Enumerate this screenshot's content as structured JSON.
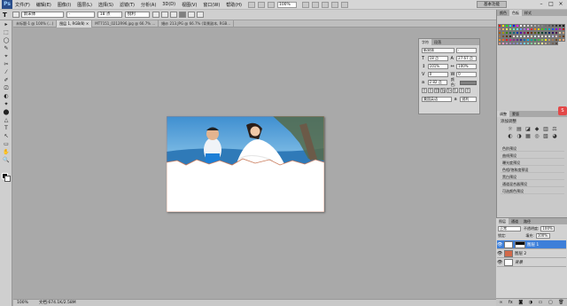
{
  "app": {
    "logo": "Ps",
    "menu": [
      "文件(F)",
      "编辑(E)",
      "图像(I)",
      "图层(L)",
      "选择(S)",
      "滤镜(T)",
      "分析(A)",
      "3D(D)",
      "视图(V)",
      "窗口(W)",
      "帮助(H)"
    ],
    "zoom": "100%",
    "workspace": "基本功能",
    "window_controls": [
      "–",
      "□",
      "×"
    ]
  },
  "options": {
    "tool": "T",
    "font_family": "新宋体",
    "font_style": "-",
    "font_size": "18 点",
    "anti_alias": "锐利"
  },
  "tabs": [
    {
      "label": "未标题-1 @ 100% (...)",
      "active": false
    },
    {
      "label": "图层 1, RGB/8) ×",
      "active": true
    },
    {
      "label": "MT7151_0212R96.jpg @ 66.7% ...",
      "active": false
    },
    {
      "label": "婚纱 213.JPG @ 66.7% (背景副本, RGB...",
      "active": false
    }
  ],
  "toolbox": [
    "▸",
    "⬚",
    "◯",
    "✎",
    "⌖",
    "✂",
    "⁄",
    "✐",
    "⎚",
    "◐",
    "✦",
    "⬤",
    "△",
    "T",
    "↖",
    "▭",
    "✋",
    "🔍"
  ],
  "status": {
    "zoom": "100%",
    "doc": "文档:674.1K/2.58M"
  },
  "character_panel": {
    "tabs": [
      "字符",
      "段落"
    ],
    "font_family": "新宋体",
    "font_style": "-",
    "size": "18 点",
    "leading": "27.67 点",
    "vertical_scale": "101%",
    "horizontal_scale": "100%",
    "kerning": "0",
    "tracking": "0",
    "baseline": "2.82 点",
    "color_label": "颜色:",
    "color": "#808080",
    "language": "美国英语",
    "aa": "锐利",
    "format_buttons": [
      "T",
      "T",
      "TT",
      "Tt",
      "T¹",
      "T,",
      "T",
      "T"
    ]
  },
  "right": {
    "swatch_tabs": [
      "颜色",
      "色板",
      "样式"
    ],
    "adjust_tabs": [
      "调整",
      "蒙版"
    ],
    "adjust_title": "添加调整",
    "adjust_icons": [
      "☼",
      "▤",
      "◪",
      "◆",
      "▥",
      "⚖",
      "◐",
      "◑",
      "▦",
      "◎",
      "▧",
      "◕"
    ],
    "presets": [
      "色阶预设",
      "曲线预设",
      "曝光度预设",
      "色相/饱和度预设",
      "黑白预设",
      "通道混合器预设",
      "可选颜色预设"
    ],
    "layers_tabs": [
      "图层",
      "通道",
      "路径"
    ],
    "blend_mode": "正常",
    "opacity_label": "不透明度:",
    "opacity": "100%",
    "fill_label": "填充:",
    "fill": "100%",
    "lock_label": "锁定:",
    "layers": [
      {
        "name": "图层 1",
        "selected": true
      },
      {
        "name": "图层 2",
        "selected": false
      },
      {
        "name": "背景",
        "selected": false
      }
    ],
    "footer_icons": [
      "∞",
      "fx",
      "◙",
      "◑",
      "▭",
      "▢",
      "🗑"
    ]
  },
  "colors": {
    "swatches": [
      "#ff0000",
      "#ffff00",
      "#00ff00",
      "#00ffff",
      "#0000ff",
      "#ff00ff",
      "#ffffff",
      "#ebebeb",
      "#d6d6d6",
      "#c2c2c2",
      "#adadad",
      "#999999",
      "#858585",
      "#707070",
      "#5c5c5c",
      "#474747",
      "#333333",
      "#1f1f1f",
      "#000000",
      "#ff6b6b",
      "#ffb36b",
      "#fff36b",
      "#a8ff6b",
      "#6bffb5",
      "#6bf3ff",
      "#6b9cff",
      "#a56bff",
      "#ff6be8",
      "#ff2a2a",
      "#ff8c1a",
      "#e6d800",
      "#56c400",
      "#00b37a",
      "#00a7c4",
      "#1a56ff",
      "#7a1aff",
      "#d900b8",
      "#b30000",
      "#b35c00",
      "#a39900",
      "#3a8a00",
      "#00704c",
      "#006a7d",
      "#0033b3",
      "#4d00b3",
      "#8a0075",
      "#660000",
      "#663300",
      "#5c5700",
      "#214f00",
      "#003f2b",
      "#003c47",
      "#001d66",
      "#2c0066",
      "#4f0043",
      "#e3c9a4",
      "#c9a07a",
      "#a8784e",
      "#7a5230",
      "#5c3a1e",
      "#3d2510",
      "#f2d4d4",
      "#d4f2dc",
      "#d4e3f2",
      "#f2efd4",
      "#e8d4f2",
      "#ffe0b3",
      "#ccf2ff",
      "#e6e6ff",
      "#fff2cc",
      "#ffd9e6",
      "#d9ffd9",
      "#c0c0ff",
      "#ffc0c0",
      "#8c6239",
      "#603913",
      "#f7941d",
      "#f26522",
      "#ed1c24",
      "#ec008c",
      "#92278f",
      "#662d91",
      "#2e3192",
      "#0072bc",
      "#00aeef",
      "#00a99d",
      "#00a651",
      "#39b54a",
      "#8dc63f",
      "#fff200",
      "#c69c6d",
      "#a67c52",
      "#754c24",
      "#fbaf5d",
      "#f9ad81",
      "#f7977a",
      "#f49ac2",
      "#bd8cbf",
      "#a187be",
      "#8781bd",
      "#8393ca",
      "#7da7d9",
      "#6dcff6",
      "#7accc8",
      "#82ca9c",
      "#a3d39c",
      "#c4df9b",
      "#fff799",
      "#c7b299",
      "#998675",
      "#736357",
      "#534741"
    ],
    "character_color": "#808080",
    "selected_layer": "#3d7fd9"
  }
}
